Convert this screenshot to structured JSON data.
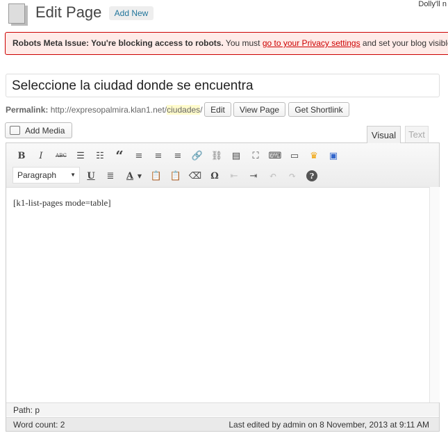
{
  "header": {
    "title": "Edit Page",
    "add_new": "Add New",
    "top_right": "Dolly'll n"
  },
  "notice": {
    "bold": "Robots Meta Issue: You're blocking access to robots.",
    "text1": " You must ",
    "link": "go to your Privacy settings",
    "text2": " and set your blog visible"
  },
  "post": {
    "title": "Seleccione la ciudad donde se encuentra"
  },
  "permalink": {
    "label": "Permalink:",
    "base": "http://expresopalmira.klan1.net/",
    "slug": "ciudades",
    "trail": "/",
    "edit": "Edit",
    "view": "View Page",
    "shortlink": "Get Shortlink"
  },
  "media": {
    "add_media": "Add Media"
  },
  "tabs": {
    "visual": "Visual",
    "text": "Text"
  },
  "toolbar": {
    "format_select": "Paragraph",
    "bold": "B",
    "italic": "I",
    "strike": "ABC",
    "quote": "“",
    "underline": "U",
    "text_color": "A",
    "special_char": "Ω",
    "help": "?"
  },
  "editor": {
    "content": "[k1-list-pages mode=table]",
    "path": "Path: p",
    "word_count": "Word count: 2",
    "last_edited": "Last edited by admin on 8 November, 2013 at 9:11 AM"
  }
}
